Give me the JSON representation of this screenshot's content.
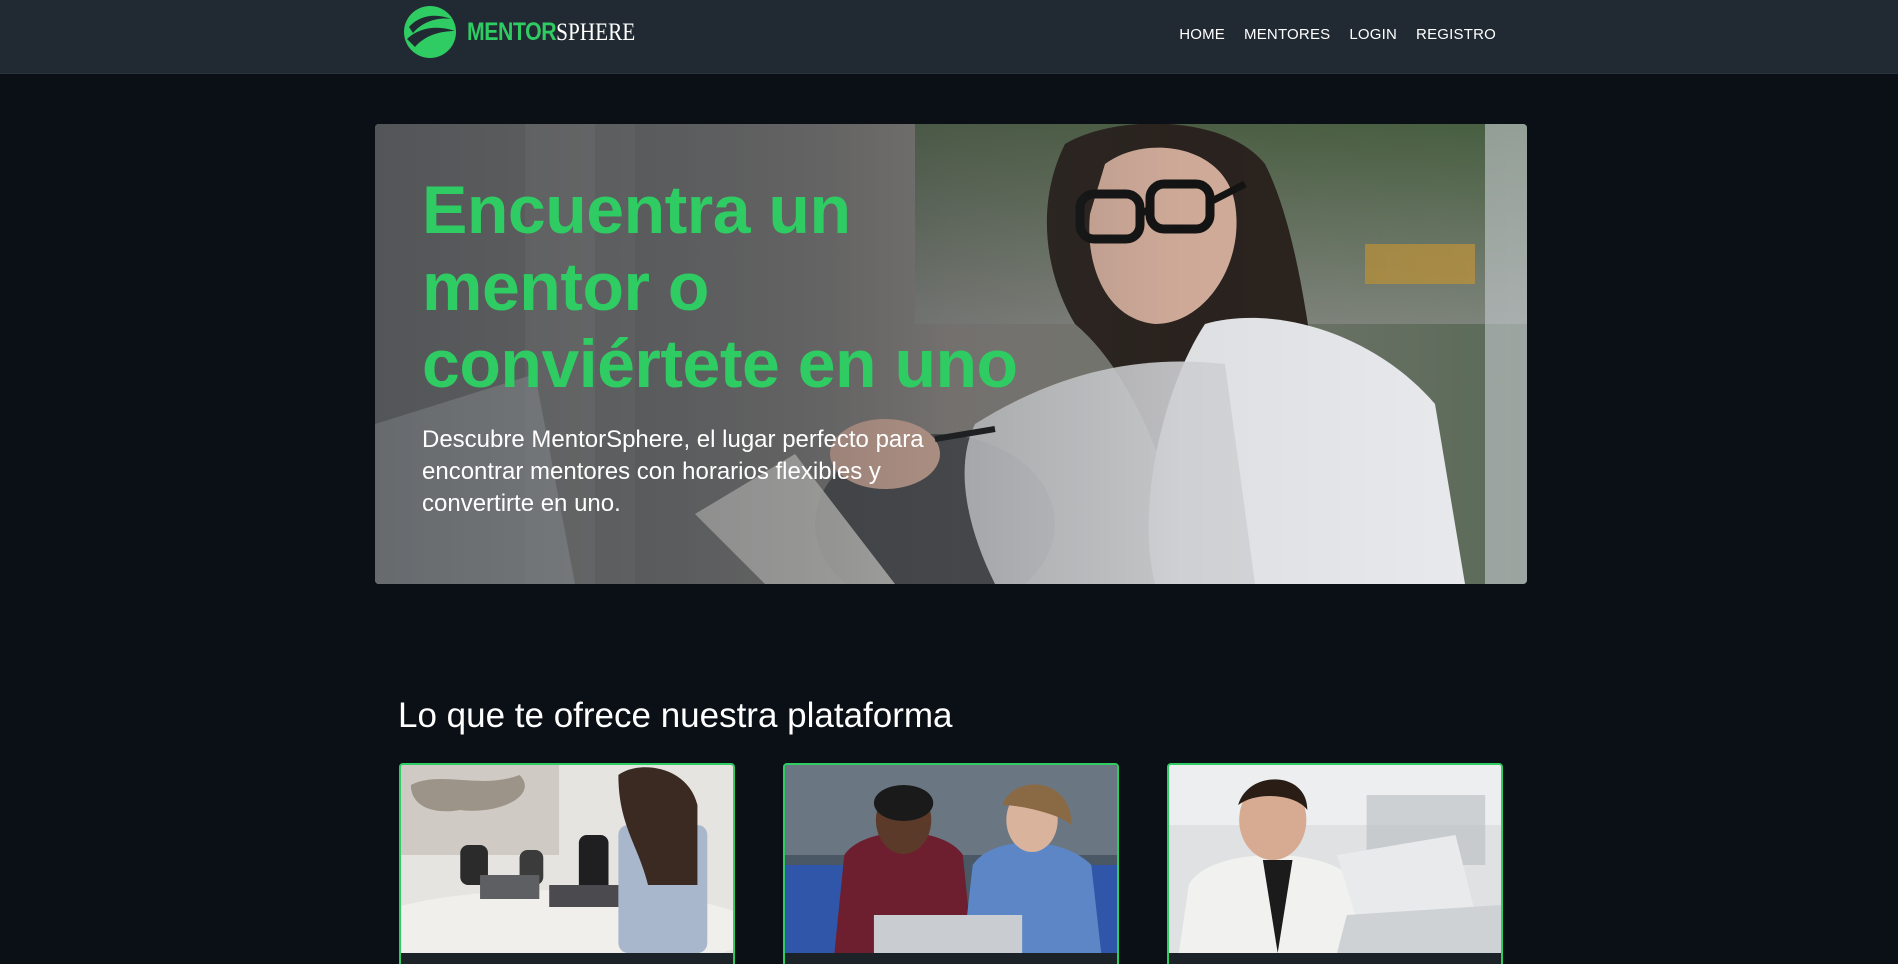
{
  "nav": {
    "brand_strong": "MENTOR",
    "brand_light": "SPHERE",
    "links": [
      "HOME",
      "MENTORES",
      "LOGIN",
      "REGISTRO"
    ]
  },
  "hero": {
    "title": "Encuentra un mentor o conviértete en uno",
    "subtitle": "Descubre MentorSphere, el lugar perfecto para encontrar mentores con horarios flexibles y convertirte en uno."
  },
  "features": {
    "title": "Lo que te ofrece nuestra plataforma"
  },
  "colors": {
    "accent": "#2ecc62",
    "navbar": "#212a32",
    "page_bg": "#0b1016"
  }
}
